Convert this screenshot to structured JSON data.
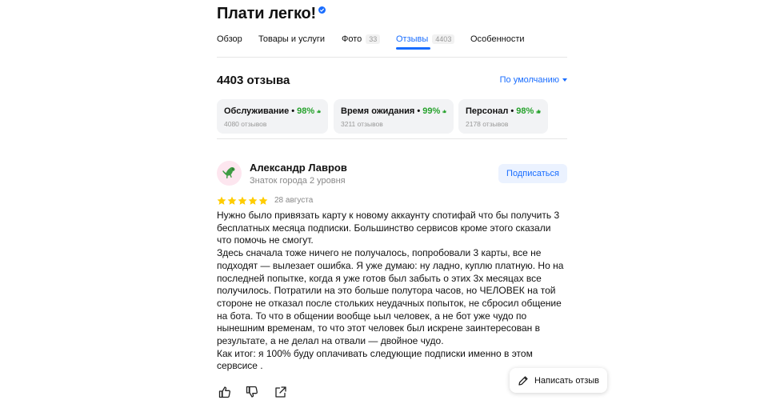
{
  "header": {
    "title": "Плати легко!",
    "verified_icon": "verified-badge-icon"
  },
  "tabs": [
    {
      "label": "Обзор"
    },
    {
      "label": "Товары и услуги"
    },
    {
      "label": "Фото",
      "count": "33"
    },
    {
      "label": "Отзывы",
      "count": "4403",
      "active": true
    },
    {
      "label": "Особенности"
    }
  ],
  "reviews_summary": {
    "title": "4403 отзыва",
    "sort_label": "По умолчанию"
  },
  "aspects": [
    {
      "label": "Обслуживание",
      "percent": "98%",
      "count": "4080 отзывов"
    },
    {
      "label": "Время ожидания",
      "percent": "99%",
      "count": "3211 отзывов"
    },
    {
      "label": "Персонал",
      "percent": "98%",
      "count": "2178 отзывов"
    }
  ],
  "review": {
    "author": "Александр Лавров",
    "level": "Знаток города 2 уровня",
    "subscribe_label": "Подписаться",
    "rating": 5,
    "date": "28 августа",
    "text": [
      "Нужно было привязать карту к новому аккаунту спотифай что бы получить 3 бесплатных месяца подписки. Большинство сервисов кроме этого сказали что помочь не смогут.",
      "Здесь сначала тоже ничего не получалось, попробовали 3 карты, все не подходят — вылезает ошибка. Я уже думаю: ну ладно, куплю платную. Но на последней попытке, когда я уже готов был забыть о этих 3х месяцах все получилось. Потратили на это больше полутора часов, но ЧЕЛОВЕК на той стороне не отказал после стольких неудачных попыток, не сбросил общение на бота. То что в общении вообще ьыл человек, а не бот уже чудо по нынешним временам, то что этот человек был искрене заинтересован в результате, а не делал на отвали — двойное чудо.",
      "Как итог: я 100% буду оплачивать следующие подписки именно в этом сервсисе ."
    ]
  },
  "write_review_label": "Написать отзыв",
  "colors": {
    "accent": "#196dff",
    "positive": "#27a22d",
    "star": "#fc0"
  }
}
